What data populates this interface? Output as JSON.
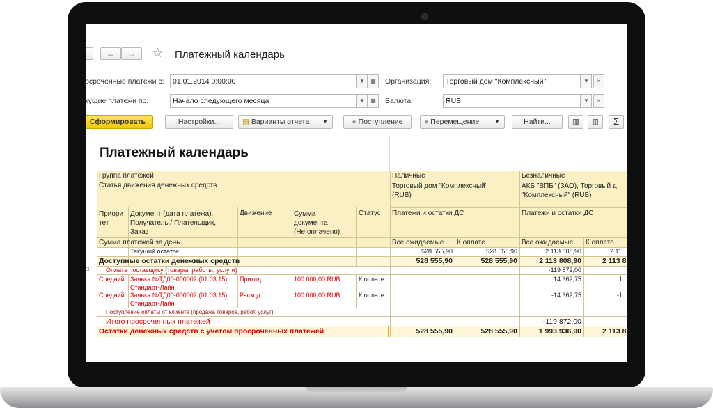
{
  "window": {
    "title": "Платежный календарь",
    "nav_back": "←",
    "nav_forward": "→",
    "star": "☆"
  },
  "filters": {
    "overdue_label": "рсроченные платежи с:",
    "overdue_value": "01.01.2014  0:00:00",
    "current_label": "кущие платежи по:",
    "current_value": "Начало следующего месяца",
    "org_label": "Организация:",
    "org_value": "Торговый дом \"Комплексный\"",
    "currency_label": "Валюта:",
    "currency_value": "RUB"
  },
  "toolbar": {
    "generate": "Сформировать",
    "settings": "Настройки...",
    "variants": "Варианты отчета",
    "income": "Поступление",
    "transfer": "Перемещение",
    "find": "Найти...",
    "sum_icon": "Σ"
  },
  "report": {
    "title": "Платежный календарь",
    "headers": {
      "group": "Группа платежей",
      "article": "Статья движения денежных средств",
      "priority": [
        "Приори",
        "тет"
      ],
      "document": [
        "Документ (дата платежа),",
        "Получатель / Плательщик,",
        "Заказ"
      ],
      "movement": "Движение",
      "amount": [
        "Сумма",
        "документа",
        "(Не оплачено)"
      ],
      "status": "Статус",
      "daily_total": "Сумма платежей за день",
      "cash": "Наличные",
      "cash_org": [
        "Торговый дом \"Комплексный\"",
        "(RUB)"
      ],
      "cash_sub": "Платежи и остатки ДС",
      "cash_expected": "Все ожидаемые",
      "cash_topay": "К оплате",
      "noncash": "Безналичные",
      "noncash_org": [
        "АКБ \"ВПБ\" (ЗАО), Торговый д",
        "\"Комплексный\" (RUB)"
      ],
      "noncash_sub": "Платежи и остатки ДС",
      "noncash_expected": "Все ожидаемые",
      "noncash_topay": "К оплате"
    },
    "rows": {
      "current_balance": {
        "label": "Текущий остаток",
        "cash_exp": "528 555,90",
        "cash_pay": "528 555,90",
        "nc_exp": "2 113 808,90",
        "nc_pay": "2 11"
      },
      "available": {
        "label": "Доступные остатки денежных средств",
        "cash_exp": "528 555,90",
        "cash_pay": "528 555,90",
        "nc_exp": "2 113 808,90",
        "nc_pay": "2 113 8"
      },
      "supplier_pay": {
        "label": "Оплата поставщику (товары, работы, услуги)",
        "nc_exp": "-119 872,00"
      },
      "doc1": {
        "priority": "Средний",
        "doc": [
          "Заявка №ТД00-000002 (01.03.15),",
          "Стандарт-Лайн"
        ],
        "movement": "Приход",
        "amount": "100 000,00 RUB",
        "status": "К оплате",
        "nc_exp": "14 362,75",
        "nc_pay": "1"
      },
      "doc2": {
        "priority": "Средний",
        "doc": [
          "Заявка №ТД00-000002 (01.03.15),",
          "Стандарт-Лайн"
        ],
        "movement": "Расход",
        "amount": "100 000,00 RUB",
        "status": "К оплате",
        "nc_exp": "-14 362,75",
        "nc_pay": "-1"
      },
      "client_income": {
        "label": "Поступление оплаты от клиента (продажа товаров, работ, услуг)"
      },
      "overdue_total": {
        "label": "Итого просроченных платежей",
        "nc_exp": "-119 872,00"
      },
      "final": {
        "label": "Остатки денежных средств с учетом просроченных платежей",
        "cash_exp": "528 555,90",
        "cash_pay": "528 555,90",
        "nc_exp": "1 993 936,90",
        "nc_pay": "2 113 8"
      }
    }
  },
  "colors": {
    "header_bg": "#fbf0c4",
    "group_bg": "#fdf6d8",
    "accent": "#f5d200",
    "red": "#e00000"
  }
}
